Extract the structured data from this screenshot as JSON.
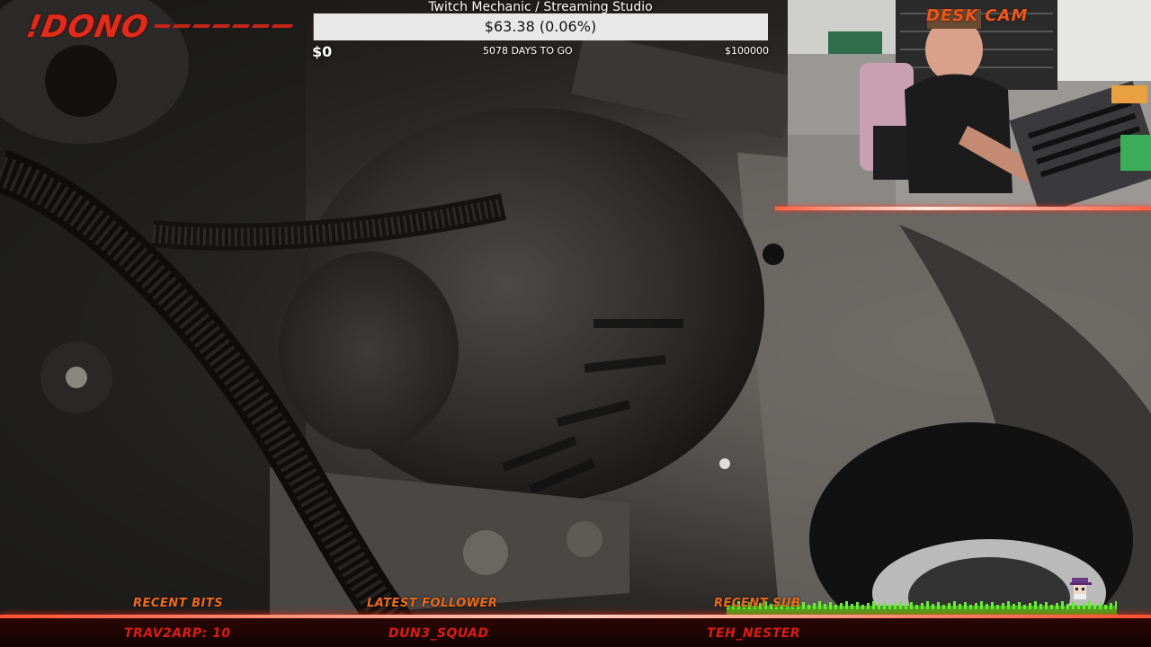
{
  "overlay": {
    "brand": "!DONO",
    "goal": {
      "title": "Twitch Mechanic / Streaming Studio",
      "progress_text": "$63.38 (0.06%)",
      "progress_fraction": 0.0006,
      "min_label": "$0",
      "days_left": "5078 DAYS TO GO",
      "max_label": "$100000"
    },
    "desk_cam": {
      "label": "DESK CAM"
    },
    "bottom": {
      "recent_bits_label": "RECENT BITS",
      "recent_bits_value": "TRAV2ARP: 10",
      "latest_follower_label": "LATEST FOLLOWER",
      "latest_follower_value": "DUN3_SQUAD",
      "recent_sub_label": "RECENT SUB",
      "recent_sub_value": "TEH_NESTER"
    }
  },
  "colors": {
    "accent_red": "#e22b1b",
    "accent_orange": "#ee6a1c",
    "glow": "#ff5030",
    "grass": "#57d32a"
  }
}
